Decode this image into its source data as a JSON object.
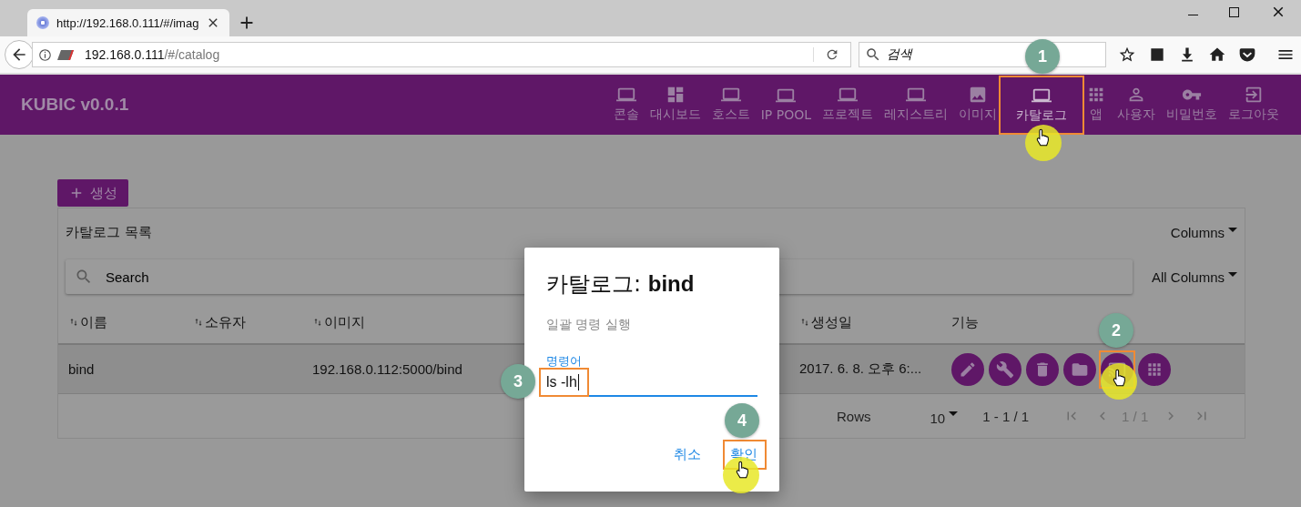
{
  "browser": {
    "tab_title": "http://192.168.0.111/#/imag",
    "url_host": "192.168.0.111",
    "url_path": "/#/catalog",
    "search_placeholder": "검색"
  },
  "app": {
    "logo": "KUBIC v0.0.1",
    "nav": [
      {
        "label": "콘솔",
        "kind": "laptop",
        "selected": false
      },
      {
        "label": "대시보드",
        "kind": "dashboard",
        "selected": false
      },
      {
        "label": "호스트",
        "kind": "laptop",
        "selected": false
      },
      {
        "label": "IP POOL",
        "kind": "laptop",
        "selected": false
      },
      {
        "label": "프로젝트",
        "kind": "laptop",
        "selected": false
      },
      {
        "label": "레지스트리",
        "kind": "laptop",
        "selected": false
      },
      {
        "label": "이미지",
        "kind": "image",
        "selected": false
      },
      {
        "label": "카탈로그",
        "kind": "laptop",
        "selected": true,
        "step": "1",
        "cursor": true
      },
      {
        "label": "앱",
        "kind": "apps",
        "selected": false
      },
      {
        "label": "사용자",
        "kind": "person",
        "selected": false
      },
      {
        "label": "비밀번호",
        "kind": "key",
        "selected": false
      },
      {
        "label": "로그아웃",
        "kind": "logout",
        "selected": false
      }
    ]
  },
  "create_button": "생성",
  "card": {
    "title": "카탈로그 목록",
    "columns_button": "Columns",
    "search_placeholder": "Search",
    "filter_button": "All Columns",
    "columns": [
      "이름",
      "소유자",
      "이미지",
      "생성일",
      "기능"
    ],
    "rows": [
      {
        "selected": true,
        "cells": [
          "bind",
          "",
          "192.168.0.112:5000/bind",
          "2017. 6. 8. 오후 6:..."
        ],
        "actions": [
          {
            "kind": "edit"
          },
          {
            "kind": "wrench"
          },
          {
            "kind": "delete"
          },
          {
            "kind": "folder"
          },
          {
            "kind": "cast",
            "step": "2",
            "cursor": true
          },
          {
            "kind": "apps"
          }
        ]
      }
    ],
    "footer": {
      "rows_label": "Rows",
      "rows_per_page": "10",
      "range": "1 - 1 / 1",
      "page": "1 / 1"
    }
  },
  "dialog": {
    "title": "카탈로그: **bind**",
    "subtitle": "일괄 명령 실행",
    "field": {
      "label": "명령어",
      "value": "ls -lh",
      "step": "3"
    },
    "buttons": [
      {
        "label": "취소"
      },
      {
        "label": "확인",
        "step": "4",
        "cursor": true
      }
    ]
  }
}
